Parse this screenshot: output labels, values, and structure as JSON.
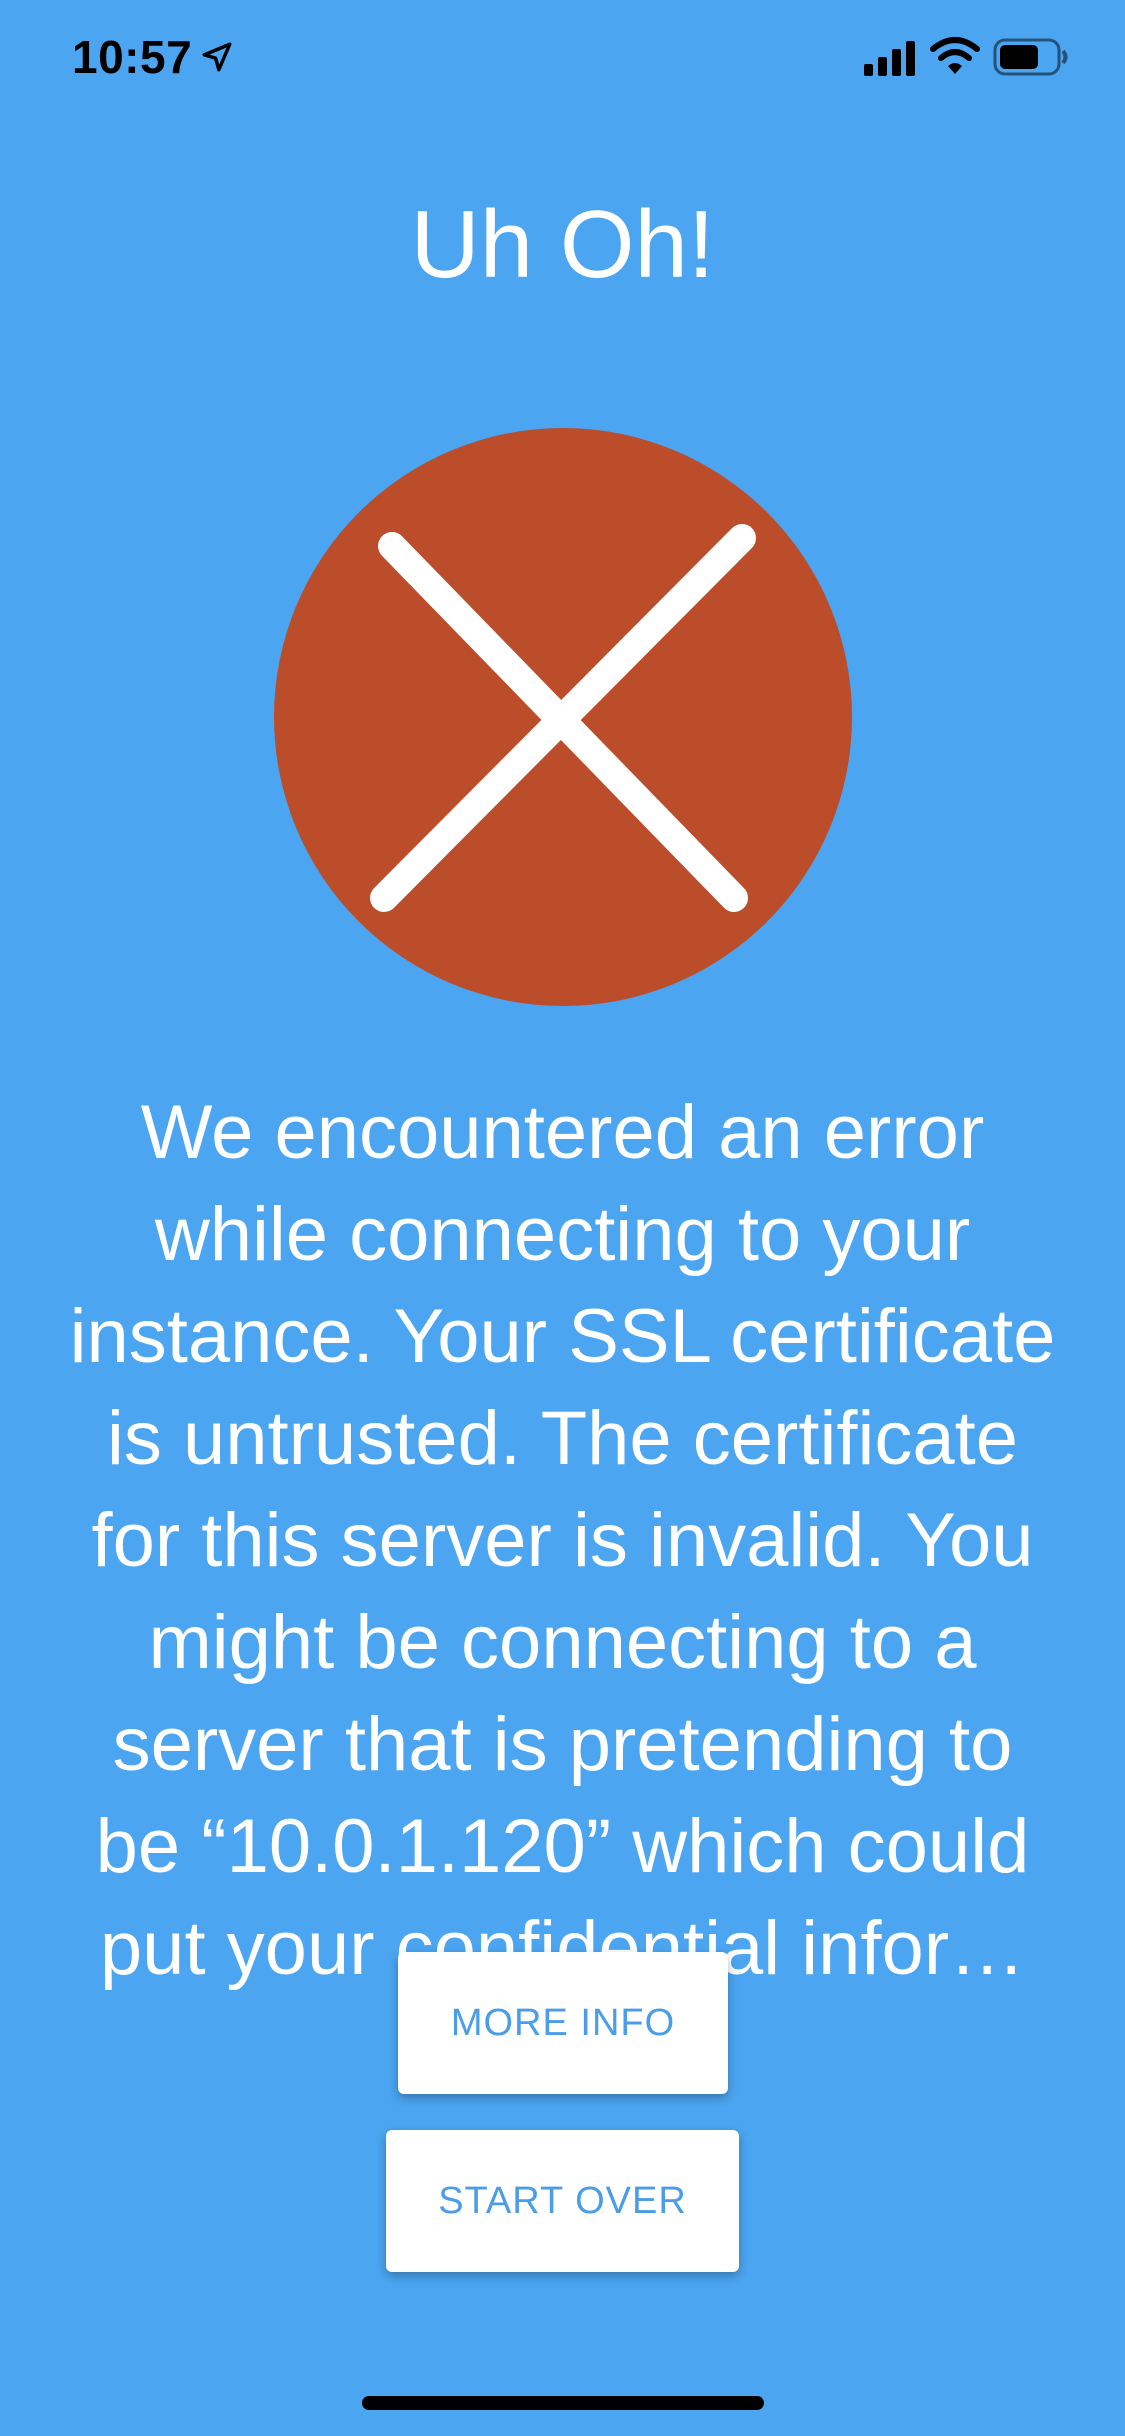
{
  "status_bar": {
    "time": "10:57",
    "icons": [
      "location-arrow-icon",
      "cellular-signal-icon",
      "wifi-icon",
      "battery-icon"
    ]
  },
  "title": "Uh Oh!",
  "error_graphic": {
    "icon": "error-x-icon",
    "circle_color": "#bb4d2a",
    "mark_color": "#ffffff"
  },
  "message": "We encountered an error while connecting to your instance. Your SSL certificate is untrusted. The certificate for this server is invalid. You might be connecting to a server that is pretending to be “10.0.1.120” which could put your confidential infor…",
  "buttons": {
    "more_info": "MORE INFO",
    "start_over": "START OVER"
  },
  "colors": {
    "background": "#4ba5f0",
    "button_text": "#4a9de6",
    "button_background": "#ffffff"
  }
}
